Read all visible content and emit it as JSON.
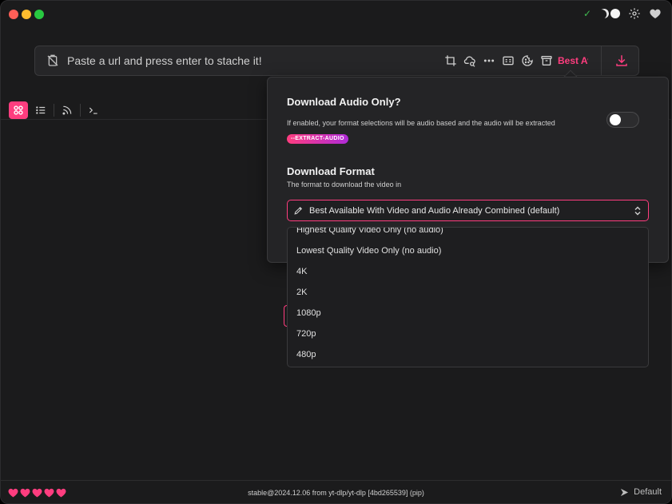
{
  "url_bar": {
    "placeholder": "Paste a url and press enter to stache it!",
    "format_label": "Best Av"
  },
  "popover": {
    "audio_title": "Download Audio Only?",
    "audio_desc": "If enabled, your format selections will be audio based and the audio will be extracted",
    "audio_badge": "--EXTRACT-AUDIO",
    "audio_enabled": false,
    "format_title": "Download Format",
    "format_desc": "The format to download the video in",
    "selected_format": "Best Available With Video and Audio Already Combined (default)"
  },
  "dropdown": {
    "items": [
      "Highest Quality Video Only (no audio)",
      "Lowest Quality Video Only (no audio)",
      "4K",
      "2K",
      "1080p",
      "720p",
      "480p"
    ]
  },
  "statusbar": {
    "version": "stable@2024.12.06 from yt-dlp/yt-dlp [4bd265539] (pip)",
    "profile": "Default"
  },
  "colors": {
    "accent": "#ff3d7f",
    "background": "#1b1b1c",
    "panel": "#242426"
  },
  "icons": {
    "titlebar": [
      "check-icon",
      "moon-icon",
      "sun-icon",
      "gear-icon",
      "heart-icon"
    ],
    "url_tools": [
      "clipboard-off-icon",
      "crop-icon",
      "cloud-search-icon",
      "more-icon",
      "subtitles-icon",
      "cookie-icon",
      "archive-icon",
      "download-icon"
    ],
    "view_tabs": [
      "grid-icon",
      "list-icon",
      "rss-icon",
      "terminal-icon"
    ]
  }
}
